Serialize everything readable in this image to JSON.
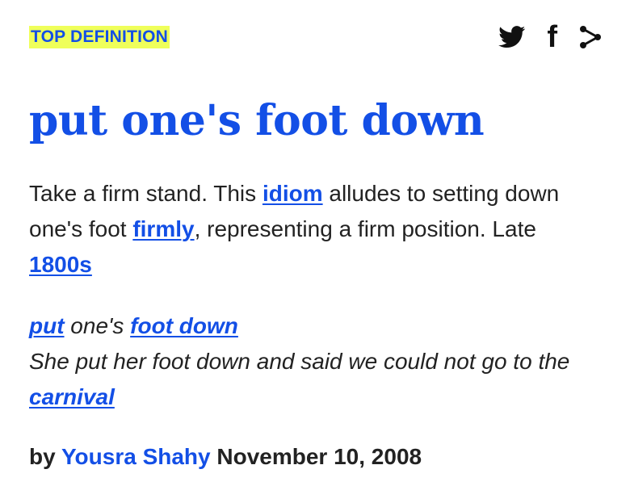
{
  "header": {
    "badge": "TOP DEFINITION",
    "share_icons": [
      "twitter-icon",
      "facebook-icon",
      "share-icon"
    ],
    "facebook_glyph": "f"
  },
  "entry": {
    "word": "put one's foot down",
    "meaning": {
      "t1": "Take a firm stand. This ",
      "l1": "idiom",
      "t2": " alludes to setting down one's foot ",
      "l2": "firmly",
      "t3": ", representing a firm position. Late ",
      "l3": "1800s"
    },
    "example": {
      "l1": "put",
      "t1": " one's ",
      "l2": "foot down",
      "t2": "She put her foot down and said we could not go to the ",
      "l3": "carnival"
    },
    "contributor": {
      "by": "by ",
      "author": "Yousra Shahy",
      "date": " November 10, 2008"
    }
  },
  "colors": {
    "accent": "#134fe6",
    "badge_bg": "#efff5a",
    "text": "#222222",
    "icon": "#111111"
  }
}
